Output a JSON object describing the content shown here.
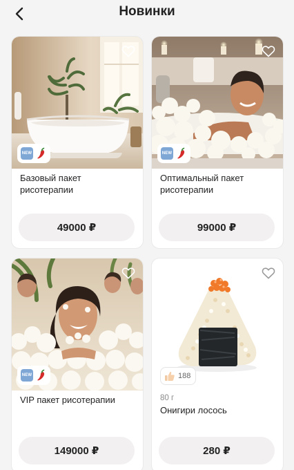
{
  "header": {
    "title": "Новинки",
    "back_icon": "chevron-left-icon"
  },
  "products": [
    {
      "name": "Базовый пакет рисотерапии",
      "price": "49000 ₽",
      "badges": [
        "NEW",
        "chili-pepper-icon"
      ],
      "favorite_icon": "heart-outline-icon",
      "image": "white bathtub in sunlit bathroom with plants"
    },
    {
      "name": "Оптимальный пакет рисотерапии",
      "price": "99000 ₽",
      "badges": [
        "NEW",
        "chili-pepper-icon"
      ],
      "favorite_icon": "heart-outline-icon",
      "image": "smiling man relaxing in bathtub full of rice"
    },
    {
      "name": "VIP пакет рисотерапии",
      "price": "149000 ₽",
      "badges": [
        "NEW",
        "chili-pepper-icon"
      ],
      "favorite_icon": "heart-outline-icon",
      "image": "laughing woman in rice bath with people in background"
    },
    {
      "name": "Онигири лосось",
      "weight": "80 г",
      "price": "280 ₽",
      "likes": "188",
      "favorite_icon": "heart-outline-icon",
      "image": "onigiri rice triangle with nori and salmon roe"
    }
  ],
  "colors": {
    "background": "#f4f4f4",
    "card": "#ffffff",
    "price_button": "#f2f0f0",
    "new_badge": "#7fa7d6",
    "chili": "#d62b2b"
  }
}
